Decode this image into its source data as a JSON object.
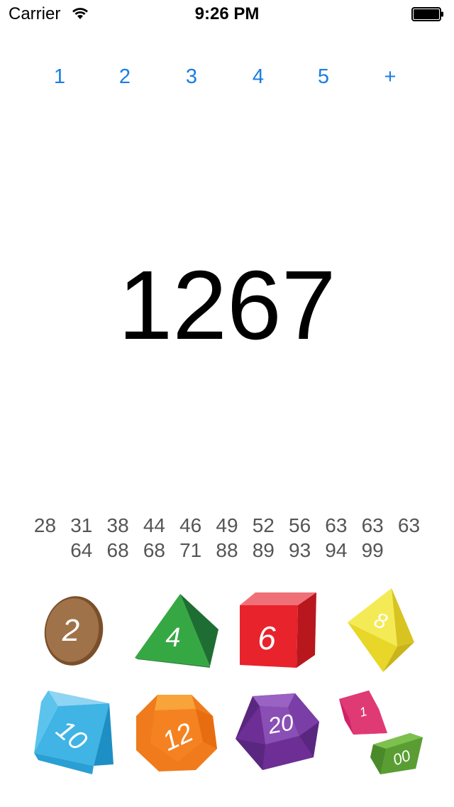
{
  "status_bar": {
    "carrier": "Carrier",
    "time": "9:26 PM"
  },
  "dice_count": {
    "options": [
      "1",
      "2",
      "3",
      "4",
      "5",
      "+"
    ],
    "accent_color": "#1a7de3"
  },
  "total": "1267",
  "rolls": [
    "28",
    "31",
    "38",
    "44",
    "46",
    "49",
    "52",
    "56",
    "63",
    "63",
    "63",
    "64",
    "68",
    "68",
    "71",
    "88",
    "89",
    "93",
    "94",
    "99"
  ],
  "dice": [
    {
      "label": "2",
      "icon": "d2-coin-icon",
      "color": "#a0724a"
    },
    {
      "label": "4",
      "icon": "d4-tetrahedron-icon",
      "color": "#36a843"
    },
    {
      "label": "6",
      "icon": "d6-cube-icon",
      "color": "#e8232b"
    },
    {
      "label": "8",
      "icon": "d8-octahedron-icon",
      "color": "#f0e02c"
    },
    {
      "label": "10",
      "icon": "d10-icon",
      "color": "#3fb4e5"
    },
    {
      "label": "12",
      "icon": "d12-dodecahedron-icon",
      "color": "#f58220"
    },
    {
      "label": "20",
      "icon": "d20-icosahedron-icon",
      "color": "#6d2f96"
    },
    {
      "label_top": "1",
      "label_bottom": "00",
      "icon": "d100-percentile-icon",
      "color_top": "#e03a74",
      "color_bottom": "#5a9e33"
    }
  ]
}
